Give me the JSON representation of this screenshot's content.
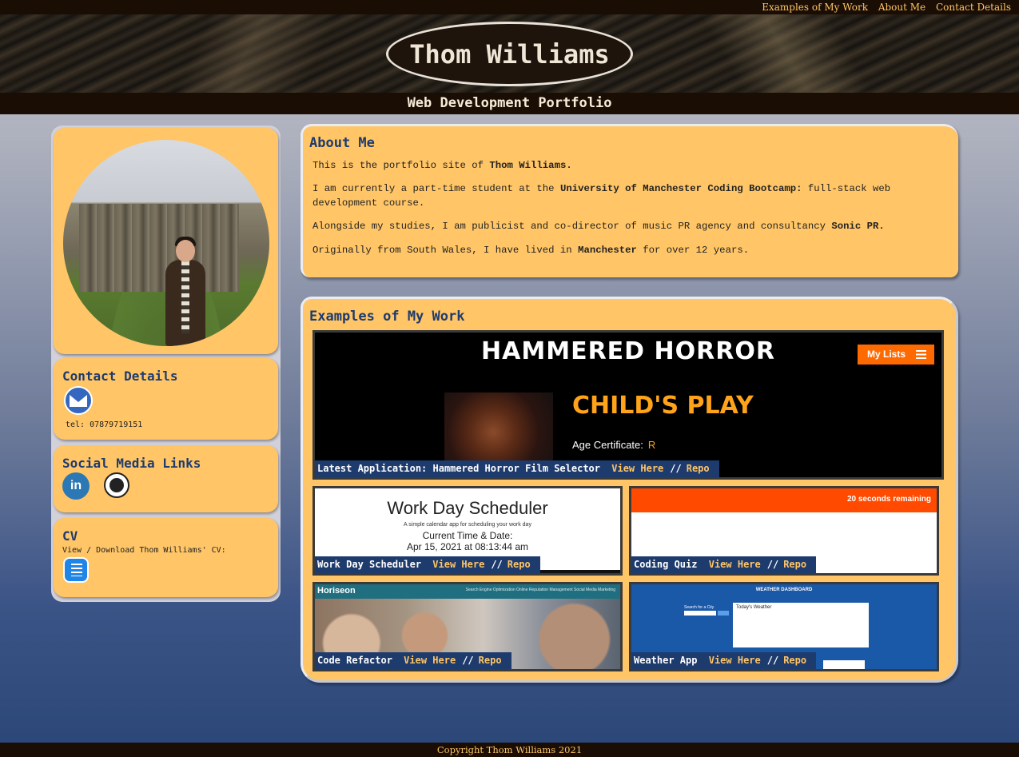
{
  "nav": {
    "work": "Examples of My Work",
    "about": "About Me",
    "contact": "Contact Details"
  },
  "header": {
    "name": "Thom Williams",
    "subtitle": "Web Development Portfolio"
  },
  "sidebar": {
    "contact": {
      "title": "Contact Details",
      "tel": "tel: 07879719151"
    },
    "social": {
      "title": "Social Media Links",
      "linkedin_glyph": "in"
    },
    "cv": {
      "title": "CV",
      "text": "View / Download Thom Williams' CV:"
    }
  },
  "about": {
    "title": "About Me",
    "p1_pre": "This is the portfolio site of ",
    "p1_bold": "Thom Williams.",
    "p2_pre": "I am currently a part-time student at the ",
    "p2_bold": "University of Manchester Coding Bootcamp:",
    "p2_post": " full-stack web development course.",
    "p3_pre": "Alongside my studies, I am publicist and co-director of music PR agency and consultancy ",
    "p3_bold": "Sonic PR.",
    "p4_pre": "Originally from South Wales, I have lived in ",
    "p4_bold": "Manchester",
    "p4_post": " for over 12 years."
  },
  "work": {
    "title": "Examples of My Work",
    "view_label": "View Here",
    "sep": "//",
    "repo_label": "Repo",
    "featured": {
      "caption": "Latest Application: Hammered Horror Film Selector",
      "screenshot": {
        "logo": "HAMMERED HORROR",
        "button": "My Lists",
        "film_title": "CHILD'S PLAY",
        "age_label": "Age Certificate:",
        "age_value": "R"
      }
    },
    "projects": [
      {
        "caption": "Work Day Scheduler",
        "screenshot": {
          "heading": "Work Day Scheduler",
          "sub": "A simple calendar app for scheduling your work day",
          "time_label": "Current Time & Date:",
          "time_value": "Apr 15, 2021 at 08:13:44 am"
        }
      },
      {
        "caption": "Coding Quiz",
        "screenshot": {
          "timer": "20 seconds remaining"
        }
      },
      {
        "caption": "Code Refactor",
        "screenshot": {
          "brand": "Horiseon",
          "links": "Search Engine Optimization    Online Reputation Management    Social Media Marketing"
        }
      },
      {
        "caption": "Weather App",
        "screenshot": {
          "title": "WEATHER DASHBOARD",
          "search": "Search for a City",
          "panel": "Today's Weather"
        }
      }
    ]
  },
  "footer": {
    "text": "Copyright Thom Williams 2021"
  },
  "colors": {
    "accent": "#ffc566",
    "navy": "#1e3b6e",
    "dark": "#1a0d04"
  }
}
